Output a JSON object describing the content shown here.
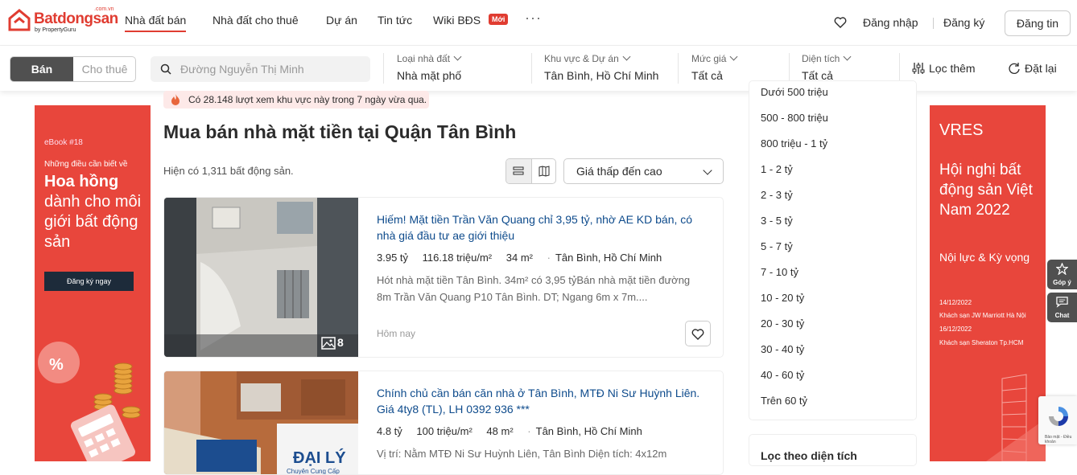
{
  "header": {
    "logo_text": "Batdongsan",
    "logo_domain": ".com.vn",
    "logo_by": "by PropertyGuru",
    "nav": [
      "Nhà đất bán",
      "Nhà đất cho thuê",
      "Dự án",
      "Tin tức",
      "Wiki BĐS"
    ],
    "nav_badge": "Mới",
    "more": "···",
    "login": "Đăng nhập",
    "register": "Đăng ký",
    "post": "Đăng tin"
  },
  "filters": {
    "mode_on": "Bán",
    "mode_off": "Cho thuê",
    "search_placeholder": "Đường Nguyễn Thị Minh",
    "groups": [
      {
        "label": "Loại nhà đất",
        "value": "Nhà mặt phố"
      },
      {
        "label": "Khu vực & Dự án",
        "value": "Tân Bình, Hồ Chí Minh"
      },
      {
        "label": "Mức giá",
        "value": "Tất cả"
      },
      {
        "label": "Diện tích",
        "value": "Tất cả"
      }
    ],
    "more": "Lọc thêm",
    "reset": "Đặt lại"
  },
  "ad_left": {
    "ebook": "eBook #18",
    "sub": "Những điều cần biết về",
    "big_bold": "Hoa hồng",
    "big_rest": "dành cho môi giới bất động sản",
    "cta": "Đăng ký ngay",
    "colors": {
      "bg": "#e8463c",
      "cta": "#1d2b3a"
    }
  },
  "ad_right": {
    "brand": "VRES",
    "headline": "Hội nghị bất động sản Việt Nam 2022",
    "slogan": "Nội lực & Kỳ vọng",
    "date1": "14/12/2022",
    "venue1": "Khách sạn JW Marriott Hà Nội",
    "date2": "16/12/2022",
    "venue2": "Khách sạn Sheraton Tp.HCM"
  },
  "main": {
    "notice": "Có 28.148 lượt xem khu vực này trong 7 ngày vừa qua.",
    "title": "Mua bán nhà mặt tiền tại Quận Tân Bình",
    "count": "Hiện có 1,311 bất động sản.",
    "sort": "Giá thấp đến cao"
  },
  "listings": [
    {
      "title": "Hiếm! Mặt tiền Trần Văn Quang chỉ 3,95 tỷ, nhờ AE KD bán, có nhà giá đầu tư ae giới thiệu",
      "price": "3.95 tỷ",
      "ppm": "116.18 triệu/m²",
      "area": "34 m²",
      "location": "Tân Bình, Hồ Chí Minh",
      "desc": "Hót nhà mặt tiền Tân Bình. 34m² có 3,95 tỷBán nhà mặt tiền đường 8m Trần Văn Quang P10 Tân Bình. DT; Ngang 6m x 7m....",
      "date": "Hôm nay",
      "photos": "8"
    },
    {
      "title": "Chính chủ cần bán căn nhà ở Tân Bình, MTĐ Ni Sư Huỳnh Liên. Giá 4ty8 (TL), LH 0392 936 ***",
      "price": "4.8 tỷ",
      "ppm": "100 triệu/m²",
      "area": "48 m²",
      "location": "Tân Bình, Hồ Chí Minh",
      "desc": "Vị trí: Nằm MTĐ Ni Sư Huỳnh Liên, Tân Bình Diện tích: 4x12m",
      "sign": "ĐẠI LÝ",
      "sign_sub": "Chuyên Cung Cấp"
    }
  ],
  "price_filter": {
    "items": [
      "Dưới 500 triệu",
      "500 - 800 triệu",
      "800 triệu - 1 tỷ",
      "1 - 2 tỷ",
      "2 - 3 tỷ",
      "3 - 5 tỷ",
      "5 - 7 tỷ",
      "7 - 10 tỷ",
      "10 - 20 tỷ",
      "20 - 30 tỷ",
      "30 - 40 tỷ",
      "40 - 60 tỷ",
      "Trên 60 tỷ"
    ]
  },
  "area_filter": {
    "title": "Lọc theo diện tích"
  },
  "floating": {
    "feedback": "Góp ý",
    "chat": "Chat"
  },
  "recaptcha": {
    "text": "Bảo mật - Điều khoản"
  }
}
